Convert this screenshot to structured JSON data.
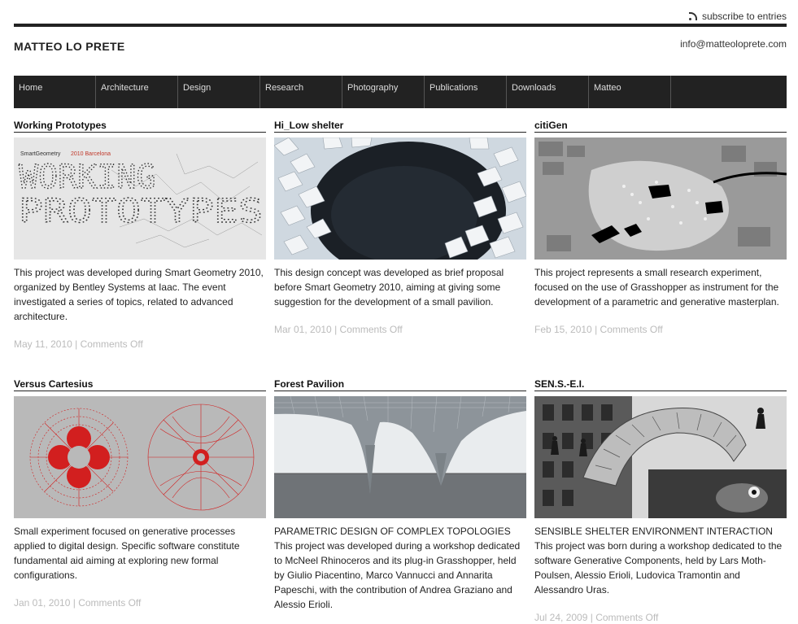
{
  "header": {
    "subscribe_label": "subscribe to entries",
    "site_title": "MATTEO LO PRETE",
    "email": "info@matteoloprete.com"
  },
  "nav": {
    "items": [
      "Home",
      "Architecture",
      "Design",
      "Research",
      "Photography",
      "Publications",
      "Downloads",
      "Matteo"
    ]
  },
  "posts": [
    {
      "title": "Working Prototypes",
      "image_caption_small": "SmartGeometry",
      "image_caption_accent": "2010 Barcelona",
      "image_line1": "WORKING",
      "image_line2": "PROTOTYPES",
      "excerpt": "This project was developed during Smart Geometry 2010, organized by Bentley Systems at Iaac. The event investigated a series of topics, related to advanced architecture.",
      "date": "May 11, 2010",
      "separator": "|",
      "comments": "Comments Off"
    },
    {
      "title": "Hi_Low shelter",
      "excerpt": "This design concept was developed as brief proposal before Smart Geometry 2010, aiming at giving some suggestion for the development of a small pavilion.",
      "date": "Mar 01, 2010",
      "separator": "|",
      "comments": "Comments Off"
    },
    {
      "title": "citiGen",
      "excerpt": "This project represents a small research experiment, focused on the use of Grasshopper as instrument for the development of a parametric and generative masterplan.",
      "date": "Feb 15, 2010",
      "separator": "|",
      "comments": "Comments Off"
    },
    {
      "title": "Versus Cartesius",
      "excerpt": "Small experiment focused on generative processes applied to digital design. Specific software constitute fundamental aid aiming at exploring new formal configurations.",
      "date": "Jan 01, 2010",
      "separator": "|",
      "comments": "Comments Off"
    },
    {
      "title": "Forest Pavilion",
      "excerpt": "PARAMETRIC DESIGN OF COMPLEX TOPOLOGIES This project was developed during a workshop dedicated to McNeel Rhinoceros and its plug-in Grasshopper, held by Giulio Piacentino, Marco Vannucci and Annarita Papeschi, with the contribution of Andrea Graziano and Alessio Erioli.",
      "date": "",
      "separator": "",
      "comments": ""
    },
    {
      "title": "SEN.S.-E.I.",
      "excerpt": "SENSIBLE SHELTER ENVIRONMENT INTERACTION This project was born during a workshop dedicated to the software Generative Components, held by Lars Moth-Poulsen, Alessio Erioli, Ludovica Tramontin and Alessandro Uras.",
      "date": "Jul 24, 2009",
      "separator": "|",
      "comments": "Comments Off"
    }
  ]
}
